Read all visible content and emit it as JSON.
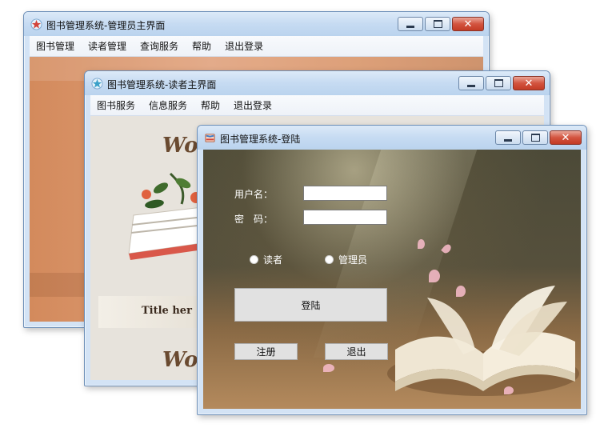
{
  "windows": {
    "admin": {
      "title": "图书管理系统-管理员主界面",
      "menu": [
        "图书管理",
        "读者管理",
        "查询服务",
        "帮助",
        "退出登录"
      ]
    },
    "reader": {
      "title": "图书管理系统-读者主界面",
      "menu": [
        "图书服务",
        "信息服务",
        "帮助",
        "退出登录"
      ],
      "poster": {
        "word_top": "Wo",
        "subtitle": "Title her",
        "word_bottom": "Wo"
      }
    },
    "login": {
      "title": "图书管理系统-登陆",
      "username_label": "用户名：",
      "password_label": "密　码：",
      "username_value": "",
      "password_value": "",
      "role_reader": "读者",
      "role_admin": "管理员",
      "login_button": "登陆",
      "register_button": "注册",
      "exit_button": "退出"
    }
  },
  "window_controls": {
    "minimize_icon": "minimize-icon",
    "maximize_icon": "maximize-icon",
    "close_glyph": "✕"
  }
}
